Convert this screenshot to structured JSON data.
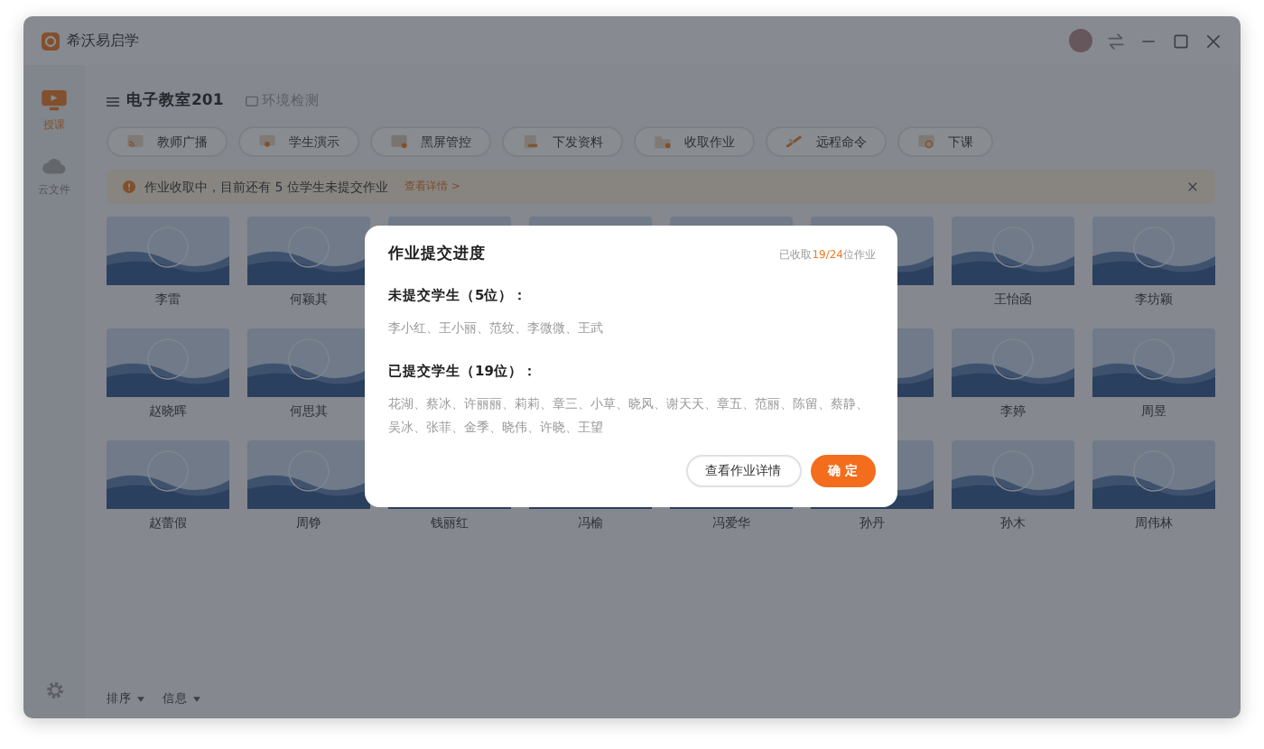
{
  "window": {
    "title": "希沃易启学"
  },
  "sidebar": {
    "items": [
      {
        "label": "授课",
        "selected": true
      },
      {
        "label": "云文件",
        "selected": false
      }
    ]
  },
  "header": {
    "classroom": "电子教室201",
    "env_check": "环境检测"
  },
  "toolbar": [
    {
      "label": "教师广播"
    },
    {
      "label": "学生演示"
    },
    {
      "label": "黑屏管控"
    },
    {
      "label": "下发资料"
    },
    {
      "label": "收取作业"
    },
    {
      "label": "远程命令"
    },
    {
      "label": "下课"
    }
  ],
  "notice": {
    "text": "作业收取中，目前还有 5 位学生未提交作业",
    "link": "查看详情 >"
  },
  "student_rows": [
    {
      "left": [
        "李雷",
        "何颖其"
      ],
      "right": [
        "王怡函",
        "李坊颖"
      ]
    },
    {
      "left": [
        "赵晓晖",
        "何思其"
      ],
      "right": [
        "李婷",
        "周昱"
      ]
    },
    {
      "left": [
        "赵蕾假",
        "周铮",
        "钱丽红",
        "冯榆",
        "冯爱华",
        "孙丹",
        "孙木",
        "周伟林"
      ]
    }
  ],
  "footer": [
    {
      "label": "排序"
    },
    {
      "label": "信息"
    }
  ],
  "dialog": {
    "title": "作业提交进度",
    "progress_prefix": "已收取",
    "progress_count": "19/24",
    "progress_suffix": "位作业",
    "sections": [
      {
        "heading": "未提交学生（5位）：",
        "names": "李小红、王小丽、范纹、李微微、王武"
      },
      {
        "heading": "已提交学生（19位）：",
        "names": "花湖、蔡冰、许丽丽、莉莉、章三、小草、晓风、谢天天、章五、范丽、陈留、蔡静、吴冰、张菲、金季、晓伟、许晓、王望"
      }
    ],
    "buttons": [
      {
        "label": "查看作业详情",
        "kind": "secondary"
      },
      {
        "label": "确 定",
        "kind": "primary"
      }
    ]
  }
}
